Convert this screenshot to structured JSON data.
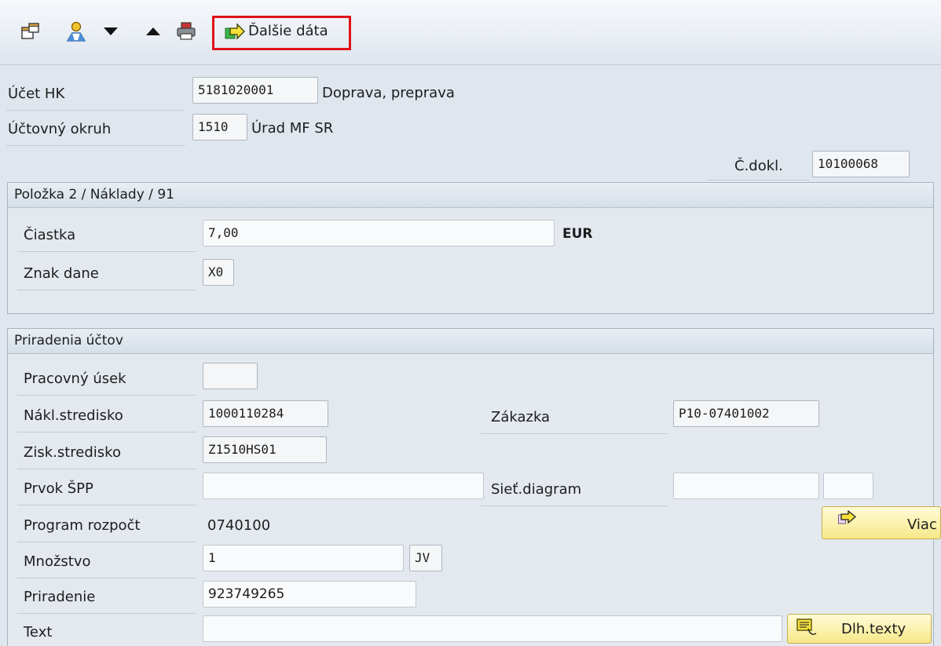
{
  "toolbar": {
    "icons": [
      "display-change-icon",
      "user-icon",
      "triangle-down-icon",
      "triangle-up-icon",
      "printer-icon"
    ],
    "more_data_label": "Ďalšie dáta"
  },
  "header": {
    "gl_account": {
      "label": "Účet HK",
      "value": "5181020001",
      "description": "Doprava, preprava"
    },
    "company_code": {
      "label": "Účtovný okruh",
      "value": "1510",
      "description": "Úrad MF SR"
    },
    "doc_no": {
      "label": "Č.dokl.",
      "value": "10100068"
    }
  },
  "item_group": {
    "title": "Položka 2 / Náklady / 91",
    "amount": {
      "label": "Čiastka",
      "value": "7,00",
      "currency": "EUR"
    },
    "tax_code": {
      "label": "Znak dane",
      "value": "X0"
    }
  },
  "assign_group": {
    "title": "Priradenia účtov",
    "business_area": {
      "label": "Pracovný úsek",
      "value": ""
    },
    "cost_center": {
      "label": "Nákl.stredisko",
      "value": "1000110284"
    },
    "order": {
      "label": "Zákazka",
      "value": "P10-07401002"
    },
    "profit_center": {
      "label": "Zisk.stredisko",
      "value": "Z1510HS01"
    },
    "wbs": {
      "label": "Prvok ŠPP",
      "value": ""
    },
    "network": {
      "label": "Sieť.diagram",
      "value": "",
      "value2": ""
    },
    "program": {
      "label": "Program rozpočt",
      "value": "0740100"
    },
    "more_button": "Viac",
    "quantity": {
      "label": "Množstvo",
      "value": "1",
      "unit": "JV"
    },
    "assignment": {
      "label": "Priradenie",
      "value": "923749265"
    },
    "text": {
      "label": "Text",
      "value": ""
    },
    "long_text_button": "Dlh.texty"
  }
}
